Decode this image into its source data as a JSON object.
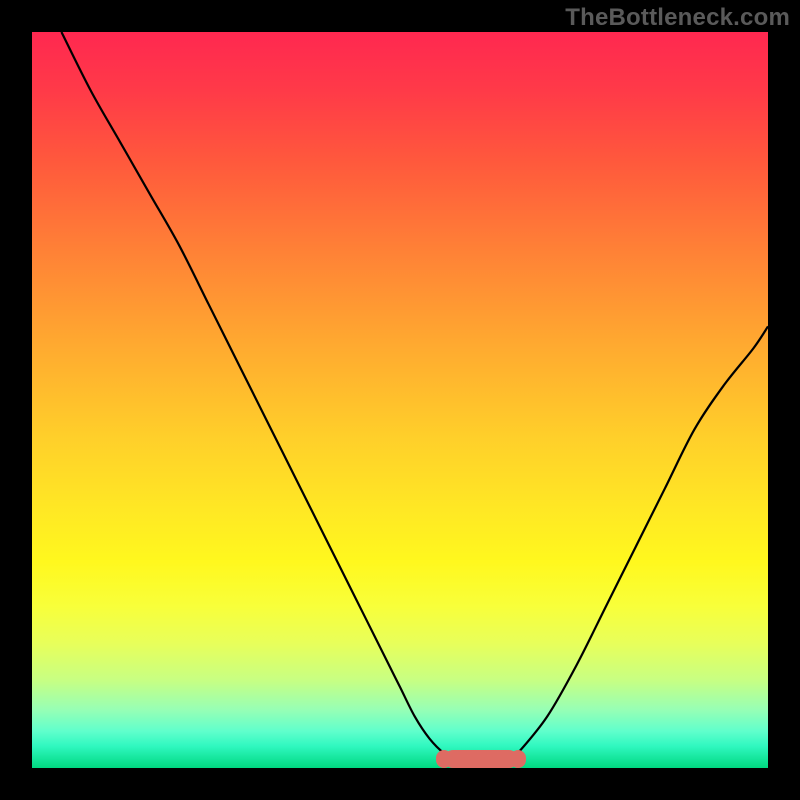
{
  "watermark": "TheBottleneck.com",
  "colors": {
    "frame_bg": "#000000",
    "curve_stroke": "#000000",
    "marker": "#de6b63",
    "watermark_text": "#5a5a5a"
  },
  "chart_data": {
    "type": "line",
    "title": "",
    "xlabel": "",
    "ylabel": "",
    "xlim": [
      0,
      100
    ],
    "ylim": [
      0,
      100
    ],
    "legend": false,
    "grid": false,
    "annotations": [
      {
        "text": "TheBottleneck.com",
        "position": "top-right"
      }
    ],
    "series": [
      {
        "name": "curve",
        "x": [
          4,
          8,
          12,
          16,
          20,
          24,
          28,
          32,
          36,
          40,
          44,
          48,
          50,
          52,
          54,
          56,
          58,
          60,
          62,
          64,
          66,
          70,
          74,
          78,
          82,
          86,
          90,
          94,
          98,
          100
        ],
        "y": [
          100,
          92,
          85,
          78,
          71,
          63,
          55,
          47,
          39,
          31,
          23,
          15,
          11,
          7,
          4,
          2,
          1,
          0,
          0,
          0,
          2,
          7,
          14,
          22,
          30,
          38,
          46,
          52,
          57,
          60
        ]
      }
    ],
    "marker": {
      "x_start": 56,
      "x_end": 66,
      "y": 0
    },
    "background_gradient_stops": [
      {
        "pos": 0,
        "color": "#ff2850"
      },
      {
        "pos": 18,
        "color": "#ff5a3c"
      },
      {
        "pos": 42,
        "color": "#ffa830"
      },
      {
        "pos": 65,
        "color": "#ffe824"
      },
      {
        "pos": 83,
        "color": "#e8ff5a"
      },
      {
        "pos": 95,
        "color": "#60ffcc"
      },
      {
        "pos": 100,
        "color": "#00d880"
      }
    ]
  }
}
